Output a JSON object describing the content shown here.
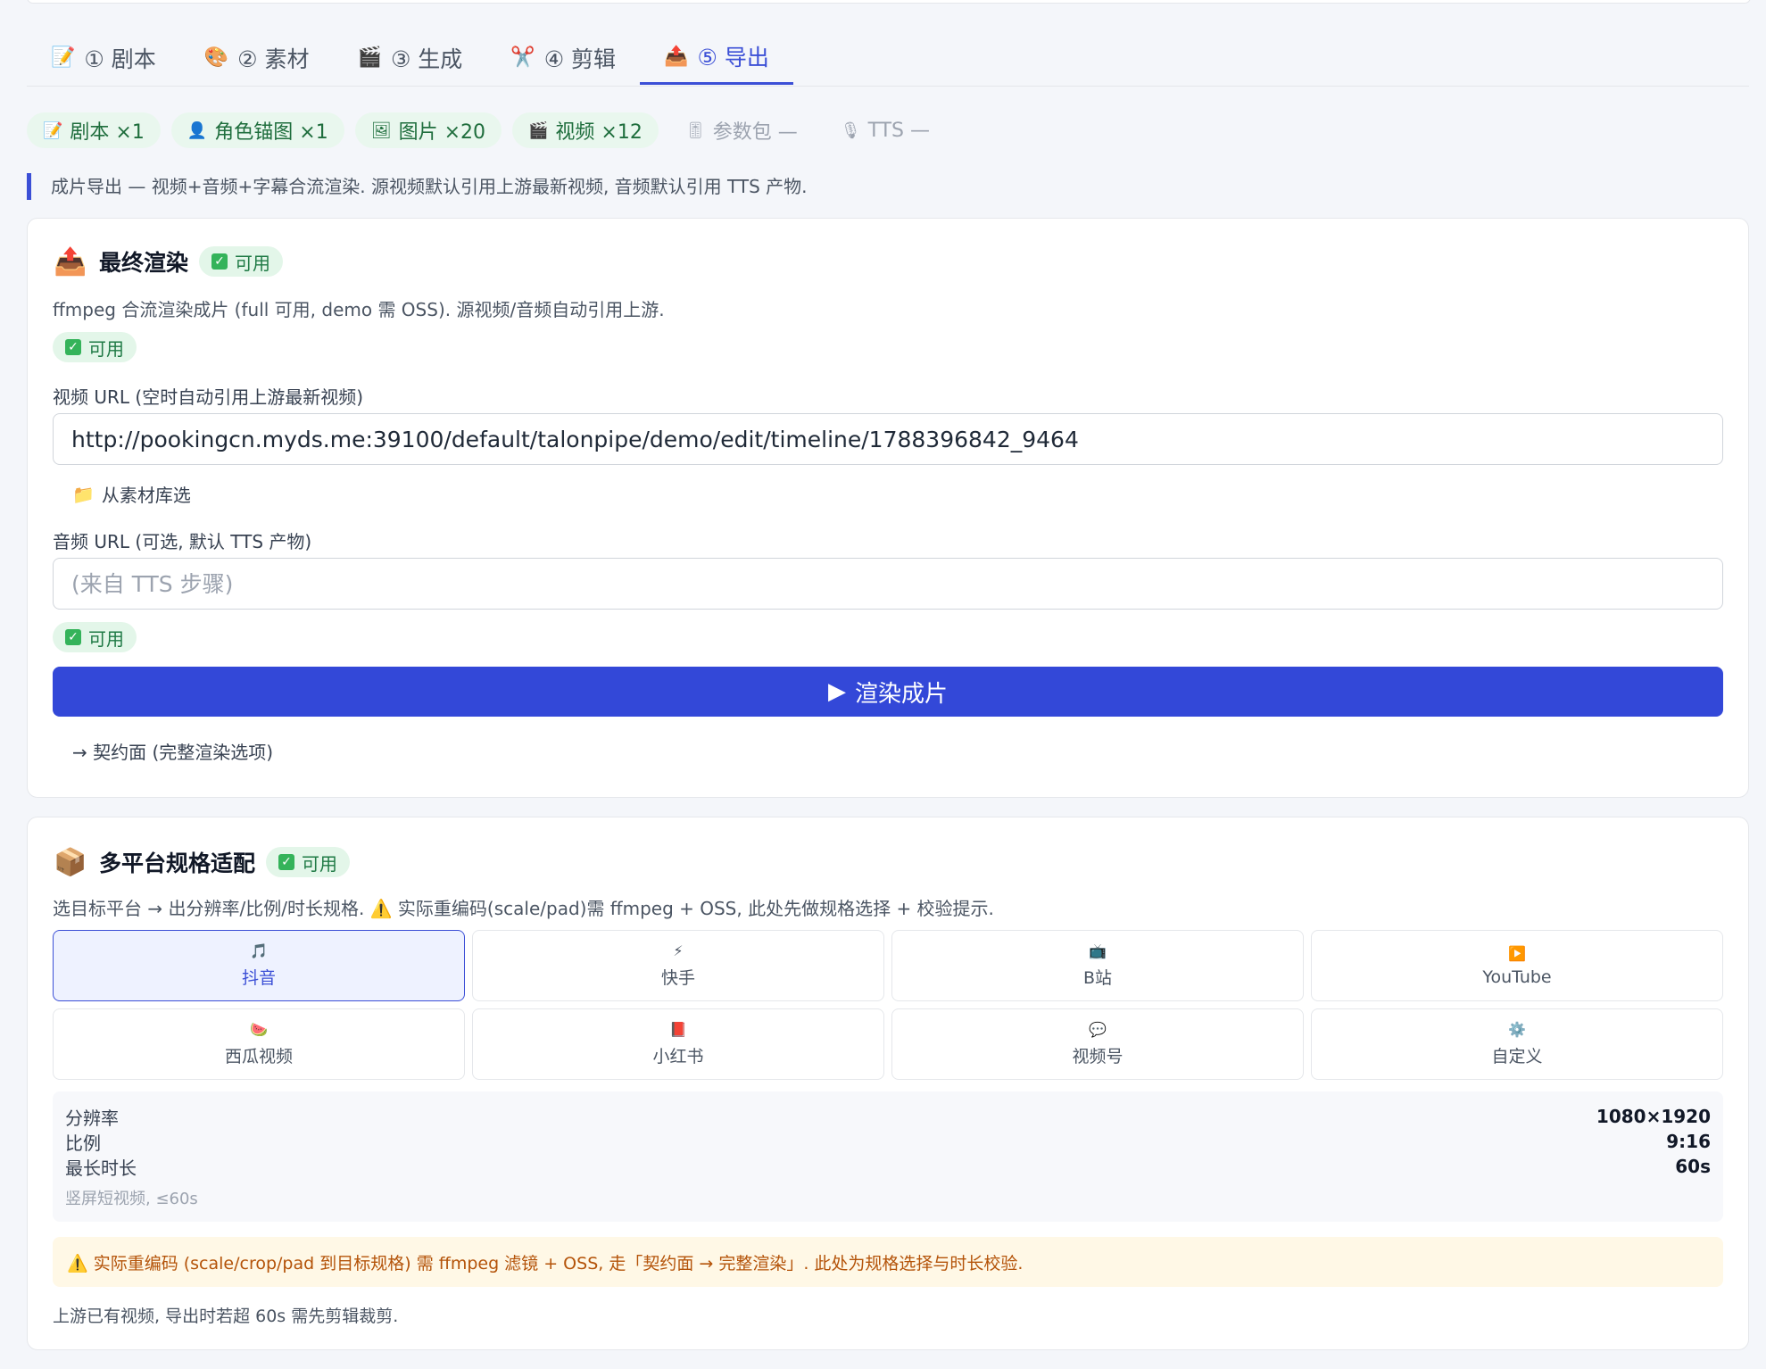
{
  "tabs": [
    {
      "icon": "📝",
      "icon_name": "memo-icon",
      "label": "① 剧本"
    },
    {
      "icon": "🎨",
      "icon_name": "palette-icon",
      "label": "② 素材"
    },
    {
      "icon": "🎬",
      "icon_name": "clapper-icon",
      "label": "③ 生成"
    },
    {
      "icon": "✂️",
      "icon_name": "scissors-icon",
      "label": "④ 剪辑"
    },
    {
      "icon": "📤",
      "icon_name": "outbox-icon",
      "label": "⑤ 导出",
      "active": true
    }
  ],
  "assets": [
    {
      "icon": "📝",
      "icon_name": "memo-icon",
      "label": "剧本 ×1"
    },
    {
      "icon": "👤",
      "icon_name": "person-icon",
      "label": "角色锚图 ×1"
    },
    {
      "icon": "🖼",
      "icon_name": "picture-icon",
      "label": "图片 ×20"
    },
    {
      "icon": "🎬",
      "icon_name": "clapper-icon",
      "label": "视频 ×12"
    },
    {
      "icon": "🎚",
      "icon_name": "slider-icon",
      "label": "参数包 —",
      "muted": true
    },
    {
      "icon": "🎙",
      "icon_name": "microphone-icon",
      "label": "TTS —",
      "muted": true
    }
  ],
  "intro": "成片导出 — 视频+音频+字幕合流渲染. 源视频默认引用上游最新视频, 音频默认引用 TTS 产物.",
  "render_card": {
    "icon": "📤",
    "title": "最终渲染",
    "badge": "可用",
    "desc": "ffmpeg 合流渲染成片 (full 可用, demo 需 OSS). 源视频/音频自动引用上游.",
    "status1": "可用",
    "video_label": "视频 URL (空时自动引用上游最新视频)",
    "video_value": "http://pookingcn.myds.me:39100/default/talonpipe/demo/edit/timeline/1788396842_9464",
    "library_icon": "📁",
    "library_label": "从素材库选",
    "audio_label": "音频 URL (可选, 默认 TTS 产物)",
    "audio_placeholder": "(来自 TTS 步骤)",
    "status2": "可用",
    "render_button": "渲染成片",
    "contract_link": "→ 契约面 (完整渲染选项)"
  },
  "platform_card": {
    "icon": "📦",
    "title": "多平台规格适配",
    "badge": "可用",
    "desc": "选目标平台 → 出分辨率/比例/时长规格. ⚠️ 实际重编码(scale/pad)需 ffmpeg + OSS, 此处先做规格选择 + 校验提示.",
    "platforms": [
      {
        "icon": "🎵",
        "icon_name": "music-note-icon",
        "label": "抖音",
        "selected": true
      },
      {
        "icon": "⚡",
        "icon_name": "lightning-icon",
        "label": "快手"
      },
      {
        "icon": "📺",
        "icon_name": "tv-icon",
        "label": "B站"
      },
      {
        "icon": "▶️",
        "icon_name": "play-icon",
        "label": "YouTube"
      },
      {
        "icon": "🍉",
        "icon_name": "watermelon-icon",
        "label": "西瓜视频"
      },
      {
        "icon": "📕",
        "icon_name": "book-icon",
        "label": "小红书"
      },
      {
        "icon": "💬",
        "icon_name": "speech-bubble-icon",
        "label": "视频号"
      },
      {
        "icon": "⚙️",
        "icon_name": "gear-icon",
        "label": "自定义"
      }
    ],
    "spec": {
      "resolution_label": "分辨率",
      "resolution_value": "1080×1920",
      "ratio_label": "比例",
      "ratio_value": "9:16",
      "duration_label": "最长时长",
      "duration_value": "60s",
      "note": "竖屏短视频, ≤60s"
    },
    "warning": "⚠️ 实际重编码 (scale/crop/pad 到目标规格) 需 ffmpeg 滤镜 + OSS, 走「契约面 → 完整渲染」. 此处为规格选择与时长校验.",
    "footer": "上游已有视频, 导出时若超 60s 需先剪辑裁剪."
  },
  "colors": {
    "accent": "#3b4fd6",
    "primary_button": "#3348d8",
    "success": "#1f7a45",
    "warning": "#b45309"
  }
}
